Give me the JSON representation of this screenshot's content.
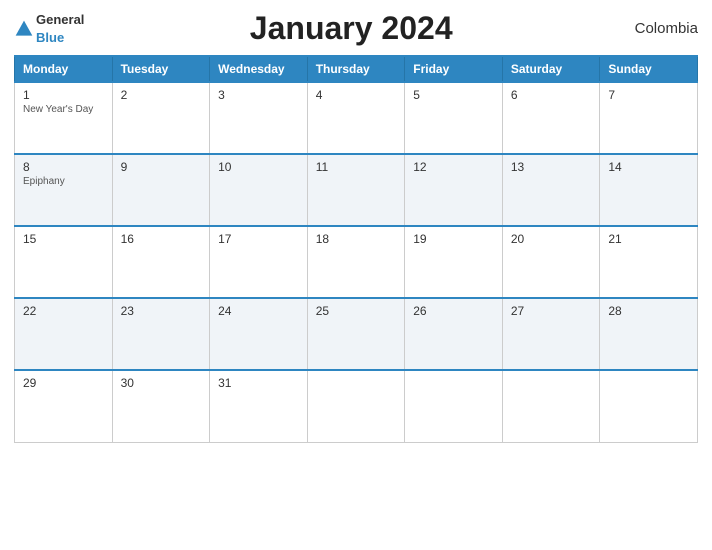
{
  "header": {
    "title": "January 2024",
    "country": "Colombia",
    "logo": {
      "general": "General",
      "blue": "Blue"
    }
  },
  "weekdays": [
    "Monday",
    "Tuesday",
    "Wednesday",
    "Thursday",
    "Friday",
    "Saturday",
    "Sunday"
  ],
  "weeks": [
    [
      {
        "day": "1",
        "holiday": "New Year's Day"
      },
      {
        "day": "2",
        "holiday": ""
      },
      {
        "day": "3",
        "holiday": ""
      },
      {
        "day": "4",
        "holiday": ""
      },
      {
        "day": "5",
        "holiday": ""
      },
      {
        "day": "6",
        "holiday": ""
      },
      {
        "day": "7",
        "holiday": ""
      }
    ],
    [
      {
        "day": "8",
        "holiday": "Epiphany"
      },
      {
        "day": "9",
        "holiday": ""
      },
      {
        "day": "10",
        "holiday": ""
      },
      {
        "day": "11",
        "holiday": ""
      },
      {
        "day": "12",
        "holiday": ""
      },
      {
        "day": "13",
        "holiday": ""
      },
      {
        "day": "14",
        "holiday": ""
      }
    ],
    [
      {
        "day": "15",
        "holiday": ""
      },
      {
        "day": "16",
        "holiday": ""
      },
      {
        "day": "17",
        "holiday": ""
      },
      {
        "day": "18",
        "holiday": ""
      },
      {
        "day": "19",
        "holiday": ""
      },
      {
        "day": "20",
        "holiday": ""
      },
      {
        "day": "21",
        "holiday": ""
      }
    ],
    [
      {
        "day": "22",
        "holiday": ""
      },
      {
        "day": "23",
        "holiday": ""
      },
      {
        "day": "24",
        "holiday": ""
      },
      {
        "day": "25",
        "holiday": ""
      },
      {
        "day": "26",
        "holiday": ""
      },
      {
        "day": "27",
        "holiday": ""
      },
      {
        "day": "28",
        "holiday": ""
      }
    ],
    [
      {
        "day": "29",
        "holiday": ""
      },
      {
        "day": "30",
        "holiday": ""
      },
      {
        "day": "31",
        "holiday": ""
      },
      {
        "day": "",
        "holiday": ""
      },
      {
        "day": "",
        "holiday": ""
      },
      {
        "day": "",
        "holiday": ""
      },
      {
        "day": "",
        "holiday": ""
      }
    ]
  ],
  "colors": {
    "header_bg": "#2E86C1",
    "accent": "#2E86C1"
  }
}
